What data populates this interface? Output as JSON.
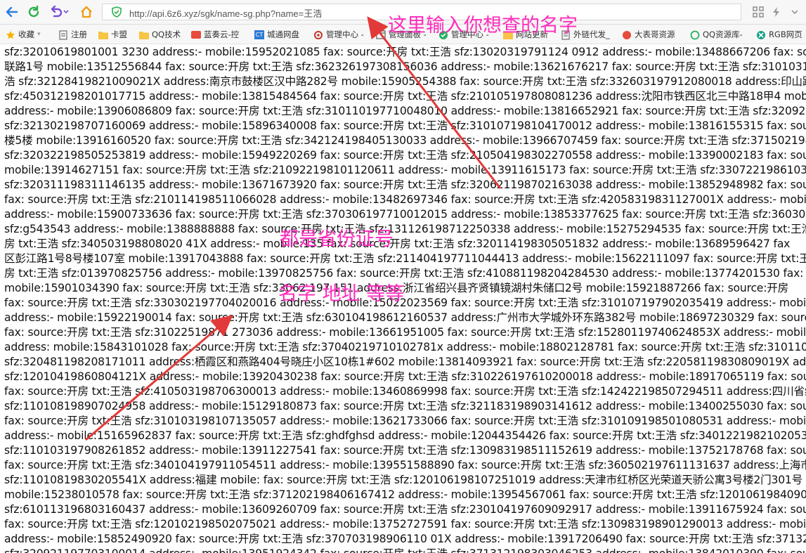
{
  "browser": {
    "url": "http://api.6z6.xyz/sgk/name-sg.php?name=王浩"
  },
  "icons": {
    "back": "back-arrow-icon",
    "refresh": "refresh-icon",
    "undo": "undo-icon",
    "home": "home-icon",
    "security": "shield-check-icon",
    "grid": "grid-apps-icon",
    "lightning": "lightning-icon",
    "menu": "chevron-down-icon"
  },
  "bookmarks": [
    {
      "label": "收藏",
      "icon": "star-icon"
    },
    {
      "label": "注册",
      "icon": "doc-icon"
    },
    {
      "label": "卡盟",
      "icon": "folder-icon"
    },
    {
      "label": "QQ技术",
      "icon": "folder-icon"
    },
    {
      "label": "蓝奏云-控",
      "icon": "cloud-icon"
    },
    {
      "label": "城通网盘",
      "icon": "ct-icon"
    },
    {
      "label": "管理中心 -",
      "icon": "gear-icon"
    },
    {
      "label": "管理面板 -",
      "icon": "panel-icon"
    },
    {
      "label": "管理中心 -",
      "icon": "check-icon"
    },
    {
      "label": "网站更新",
      "icon": "folder-icon"
    },
    {
      "label": "外链代发_",
      "icon": "doc-icon"
    },
    {
      "label": "大表哥资源",
      "icon": "dbg-icon"
    },
    {
      "label": "QQ资源库-",
      "icon": "qq-icon"
    },
    {
      "label": "RGB网页",
      "icon": "rgb-icon"
    }
  ],
  "annotations": {
    "top": "这里输入你想查的名字",
    "middle1": "都是省份证号",
    "middle2": "名字 地址 等等"
  },
  "colors": {
    "annotation": "#ff2bbd",
    "arrow": "#e23a3a",
    "green": "#2bb24c",
    "orange": "#f39c12",
    "purple": "#7a4fd6"
  },
  "lines": [
    "sfz:32010619801001 3230 address:- mobile:15952021085 fax: source:开房 txt:王浩 sfz:13020319791124 0912 address:- mobile:13488667206 fax: source:开房",
    "联路1号 mobile:13512556844 fax: source:开房 txt:王浩 sfz:362326197308156036 address:- mobile:13621676217 fax: source:开房 txt:王浩 sfz:310103198",
    "浩 sfz:32128419821009021X address:南京市鼓楼区汉中路282号 mobile:15905254388 fax: source:开房 txt:王浩 sfz:332603197912080018 address:印山路 mo",
    "sfz:450312198201017715 address:- mobile:13815484564 fax: source:开房 txt:王浩 sfz:210105197808081236 address:沈阳市铁西区北三中路18甲4 mobile:1",
    "address:- mobile:13906086809 fax: source:开房 txt:王浩 sfz:310110197710048010 address:- mobile:13816652921 fax: source:开房 txt:王浩 sfz:32092219",
    "sfz:321302198707160069 address:- mobile:15896340008 fax: source:开房 txt:王浩 sfz:310107198104170012 address:- mobile:13816155315 fax: source:开房",
    "楼5楼 mobile:13916160520 fax: source:开房 txt:王浩 sfz:342124198405130033 address:- mobile:13966707459 fax: source:开房 txt:王浩 sfz:3715021986",
    "sfz:320322198505253819 address:- mobile:15949220269 fax: source:开房 txt:王浩 sfz:210504198302270558 address:- mobile:13390002183 fax: source:开房",
    "mobile:13914627151 fax: source:开房 txt:王浩 sfz:210922198101120611 address:- mobile:13911615173 fax: source:开房 txt:王浩 sfz:3307221986103164",
    "sfz:320311198311146135 address:- mobile:13671673920 fax: source:开房 txt:王浩 sfz:320621198702163038 address:- mobile:13852948982 fax: source:开房",
    "fax: source:开房 txt:王浩 sfz:210114198511066028 address:- mobile:13482697346 fax: source:开房 txt:王浩 sfz:42058319831127001X address:- mobile:13",
    "address:- mobile:15900733636 fax: source:开房 txt:王浩 sfz:370306197710012015 address:- mobile:13853377625 fax: source:开房 txt:王浩 sfz:36030219",
    "sfz:g543543 address:- mobile:1388888888 fax: source:开房 txt:王浩 sfz:131126198712250338 address:- mobile:15275294535 fax: source:开房 txt:王浩 sfz:",
    "房 txt:王浩 sfz:340503198808020 41X address:- mobile:135 fax: source:开房 txt:王浩 sfz:320114198305051832 address:- mobile:13689596427 fax",
    "区彭江路1号8号楼107室 mobile:13917043888 fax: source:开房 txt:王浩 sfz:211404197711044413 address:- mobile:15622111097 fax: source:开房 txt:王浩 s",
    "房 txt:王浩 sfz:013970825756 address:- mobile:13970825756 fax: source:开房 txt:王浩 sfz:410881198204284530 address:- mobile:13774201530 fax: sou",
    "mobile:15901034390 fax: source:开房 txt:王浩 sfz:33062 197 151 address:浙江省绍兴县齐贤镇镜湖村朱储口2号 mobile:15921887266 fax: source:开房",
    "fax: source:开房 txt:王浩 sfz:330302197704020016 address:- mobile:15022023569 fax: source:开房 txt:王浩 sfz:310107197902035419 address:- mobile:156",
    "address:- mobile:15922190014 fax: source:开房 txt:王浩 sfz:630104198612160537 address:广州市大学城外环东路382号 mobile:18697230329 fax: source:开",
    "fax: source:开房 txt:王浩 sfz:31022519871 273036 address:- mobile:13661951005 fax: source:开房 txt:王浩 sfz:15280119740624853X address:- mobile:15",
    "address: mobile:15843101028 fax: source:开房 txt:王浩 sfz:37040219710102781x address:- mobile:18802128781 fax: source:开房 txt:王浩 sfz:3101101980",
    "sfz:320481198208171011 address:栖霞区和燕路404号晓庄小区10栋1#602 mobile:13814093921 fax: source:开房 txt:王浩 sfz:22058119830809019X address",
    "sfz:12010419860804121X address:- mobile:13920430238 fax: source:开房 txt:王浩 sfz:310226197610200018 address:- mobile:18917065119 fax: source:开",
    "fax: source:开房 txt:王浩 sfz:410503198706300013 address:- mobile:13460869998 fax: source:开房 txt:王浩 sfz:142422198507294511 address:四川省绵阳市",
    "sfz:110108198907024958 address:- mobile:15129180873 fax: source:开房 txt:王浩 sfz:321183198903141612 address:- mobile:13400255030 fax: source:开",
    "fax: source:开房 txt:王浩 sfz:310103198107135057 address:- mobile:13621733066 fax: source:开房 txt:王浩 sfz:310109198501080531 address:- mobile:138",
    "address:- mobile:15165962837 fax: source:开房 txt:王浩 sfz:ghdfghsd address:- mobile:12044354426 fax: source:开房 txt:王浩 sfz:34012219821020531",
    "sfz:110103197908261852 address:- mobile:13911227541 fax: source:开房 txt:王浩 sfz:130983198511152619 address:- mobile:13752178768 fax: source:开",
    "fax: source:开房 txt:王浩 sfz:340104197911054511 address:- mobile:139551588890 fax: source:开房 txt:王浩 sfz:360502197611131637 address:上海市卢湾",
    "sfz:11010819830205541X address:福建 mobile: fax: source:开房 txt:王浩 sfz:120106198107251019 address:天津市红桥区光荣道天骄公寓3号楼2门301号 mo",
    "mobile:15238010578 fax: source:开房 txt:王浩 sfz:371202198406167412 address:- mobile:13954567061 fax: source:开房 txt:王浩 sfz:120106198409021",
    "sfz:610113196803160437 address:- mobile:13609260709 fax: source:开房 txt:王浩 sfz:230104197609092917 address:- mobile:13911675924 fax: source:开",
    "fax: source:开房 txt:王浩 sfz:120102198502075021 address:- mobile:13752727591 fax: source:开房 txt:王浩 sfz:130983198901290013 address:- mobile:13",
    "address:- mobile:15852490920 fax: source:开房 txt:王浩 sfz:370703198906110 01X address:- mobile:13917206490 fax: source:开房 txt:王浩 sfz:371326198",
    "sfz:320921197703100014 address:- mobile:13951924342 fax: source:开房 txt:王浩 sfz:371312198303046253 address:- mobile:13842010390 fax: source:开"
  ]
}
